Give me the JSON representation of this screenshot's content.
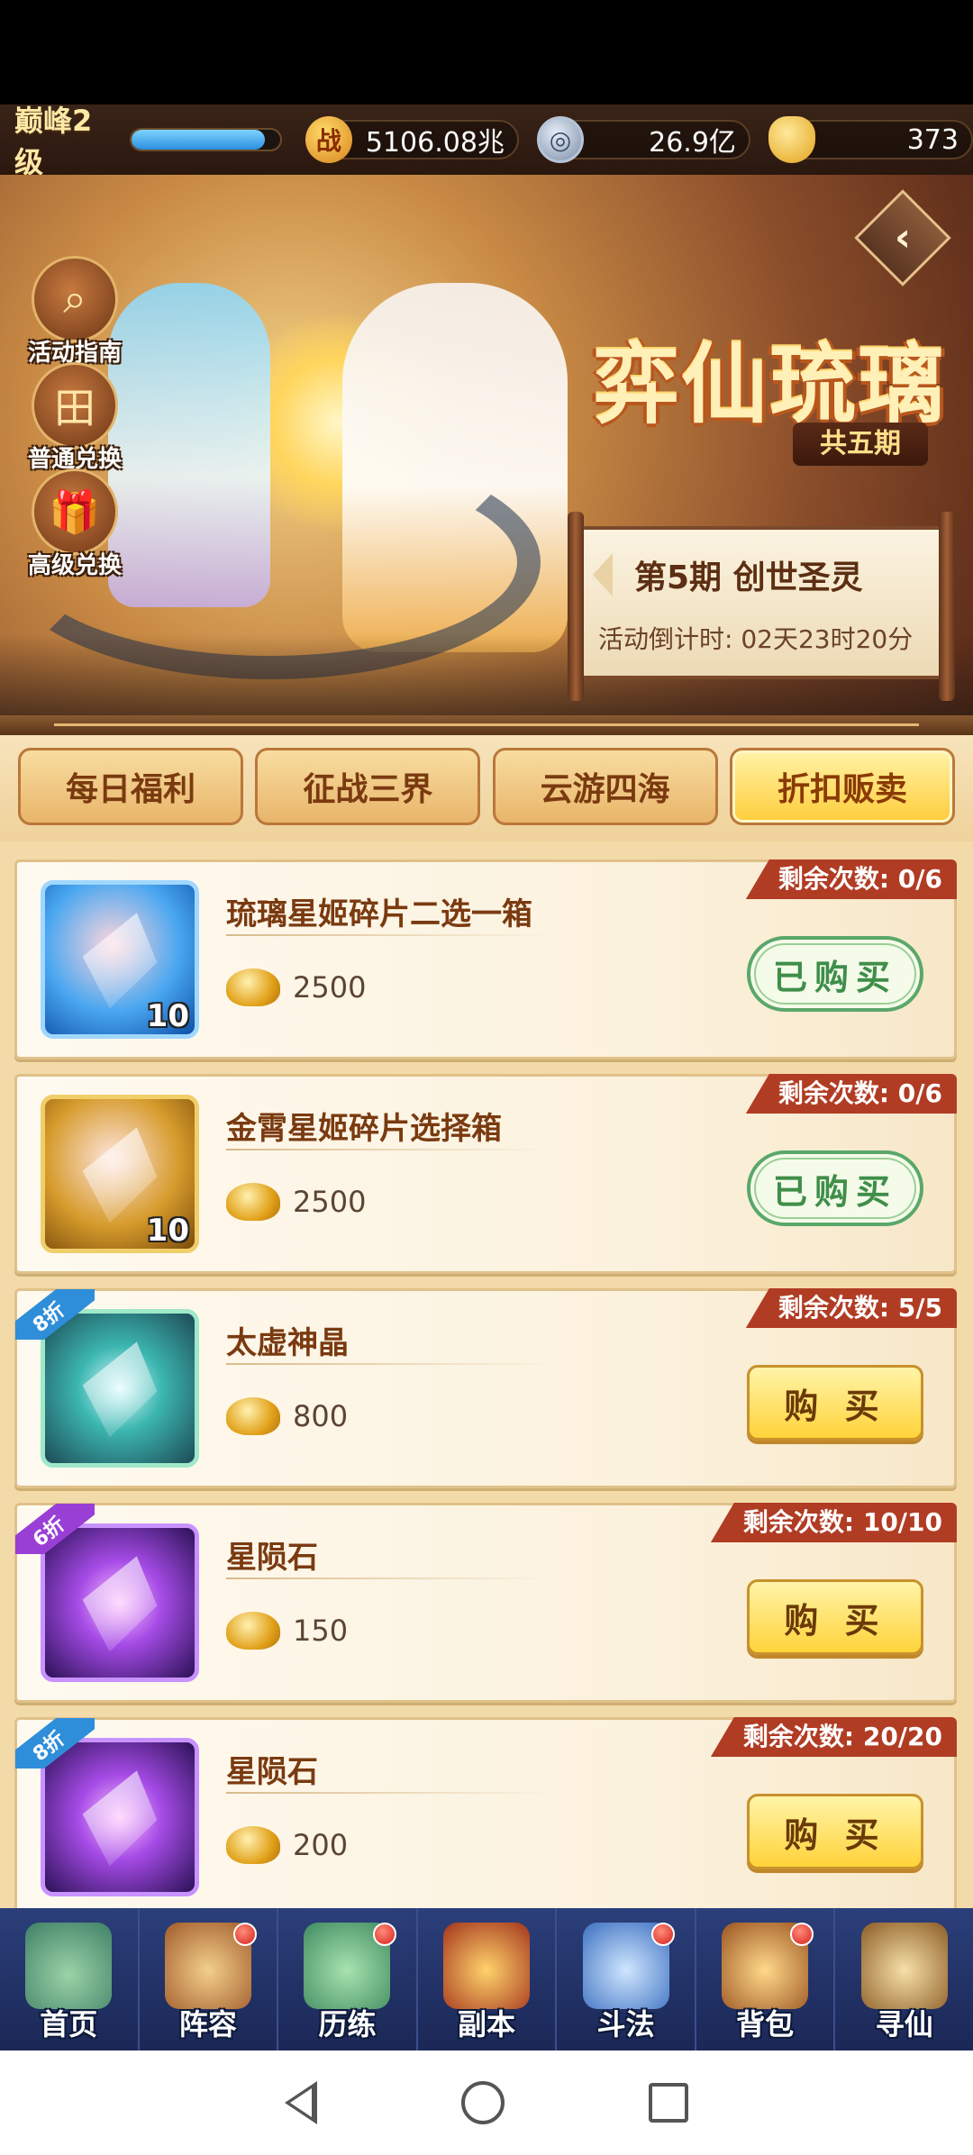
{
  "resources": {
    "rank": "巅峰2级",
    "xp_fraction": 0.9,
    "power": "5106.08兆",
    "power_icon": "战",
    "copper": "26.9亿",
    "ingot": "373"
  },
  "banner": {
    "title": "弈仙琉璃",
    "periods": "共五期",
    "current_period": "第5期  创世圣灵",
    "countdown": "活动倒计时: 02天23时20分",
    "side_buttons": [
      {
        "label": "活动指南",
        "icon": "magnifier-icon"
      },
      {
        "label": "普通兑换",
        "icon": "exchange-icon"
      },
      {
        "label": "高级兑换",
        "icon": "gift-icon"
      }
    ]
  },
  "tabs": [
    {
      "label": "每日福利"
    },
    {
      "label": "征战三界"
    },
    {
      "label": "云游四海"
    },
    {
      "label": "折扣贩卖",
      "active": true
    }
  ],
  "items": [
    {
      "name": "琉璃星姬碎片二选一箱",
      "price": "2500",
      "remain": "剩余次数: 0/6",
      "button": "已购买",
      "state": "bought",
      "count": "10",
      "discount": ""
    },
    {
      "name": "金霄星姬碎片选择箱",
      "price": "2500",
      "remain": "剩余次数: 0/6",
      "button": "已购买",
      "state": "bought",
      "count": "10",
      "discount": ""
    },
    {
      "name": "太虚神晶",
      "price": "800",
      "remain": "剩余次数: 5/5",
      "button": "购 买",
      "state": "buy",
      "count": "",
      "discount": "8折"
    },
    {
      "name": "星陨石",
      "price": "150",
      "remain": "剩余次数: 10/10",
      "button": "购 买",
      "state": "buy",
      "count": "",
      "discount": "6折"
    },
    {
      "name": "星陨石",
      "price": "200",
      "remain": "剩余次数: 20/20",
      "button": "购 买",
      "state": "buy",
      "count": "",
      "discount": "8折"
    }
  ],
  "nav": [
    {
      "label": "首页",
      "badge": false
    },
    {
      "label": "阵容",
      "badge": true
    },
    {
      "label": "历练",
      "badge": true
    },
    {
      "label": "副本",
      "badge": false
    },
    {
      "label": "斗法",
      "badge": true
    },
    {
      "label": "背包",
      "badge": true
    },
    {
      "label": "寻仙",
      "badge": false
    }
  ],
  "colors": {
    "accent": "#ffd33a",
    "bought_green": "#3f8e4a",
    "remain_red": "#b13c24",
    "nav_blue": "#2b3f7a"
  }
}
